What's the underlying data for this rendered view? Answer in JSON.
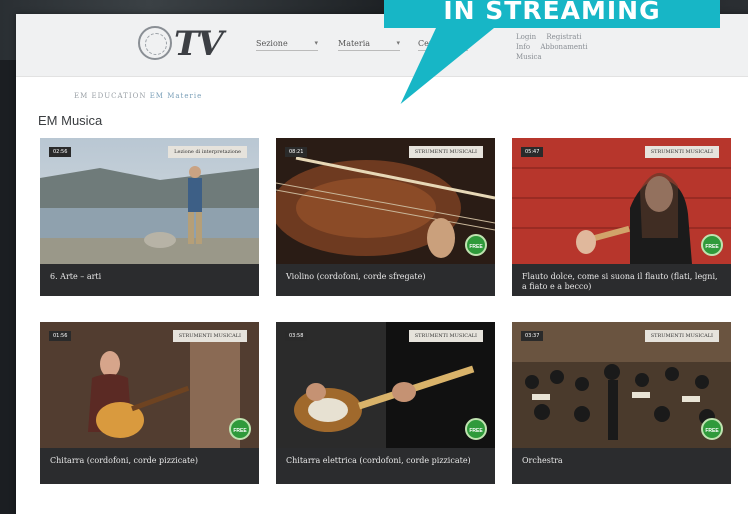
{
  "app": {
    "logo_text": "TV"
  },
  "banner": {
    "text": "IN STREAMING",
    "color": "#17b6c6"
  },
  "nav": {
    "selects": [
      {
        "label": "Sezione"
      },
      {
        "label": "Materia"
      },
      {
        "label": "Cerca..."
      }
    ],
    "links": [
      "Login",
      "Registrati",
      "Info",
      "Abbonamenti",
      "Musica"
    ]
  },
  "breadcrumb": {
    "prefix": "EM EDUCATION",
    "active": "EM Materie"
  },
  "section": {
    "title": "EM Musica"
  },
  "cards": [
    {
      "duration": "02:56",
      "tag": "Lezione di interpretazione",
      "caption": "6. Arte – arti",
      "badge": ""
    },
    {
      "duration": "08:21",
      "tag": "STRUMENTI MUSICALI",
      "caption": "Violino (cordofoni, corde sfregate)",
      "badge": "FREE"
    },
    {
      "duration": "05:47",
      "tag": "STRUMENTI MUSICALI",
      "caption": "Flauto dolce, come si suona il flauto (flati, legni, a fiato e a becco)",
      "badge": "FREE"
    },
    {
      "duration": "01:56",
      "tag": "STRUMENTI MUSICALI",
      "caption": "Chitarra (cordofoni, corde pizzicate)",
      "badge": "FREE"
    },
    {
      "duration": "03:58",
      "tag": "STRUMENTI MUSICALI",
      "caption": "Chitarra elettrica (cordofoni, corde pizzicate)",
      "badge": "FREE"
    },
    {
      "duration": "03:37",
      "tag": "STRUMENTI MUSICALI",
      "caption": "Orchestra",
      "badge": "FREE"
    }
  ],
  "colors": {
    "card_bg": "#2c2d2f",
    "badge": "#2f9a3b",
    "accent": "#17b6c6"
  }
}
